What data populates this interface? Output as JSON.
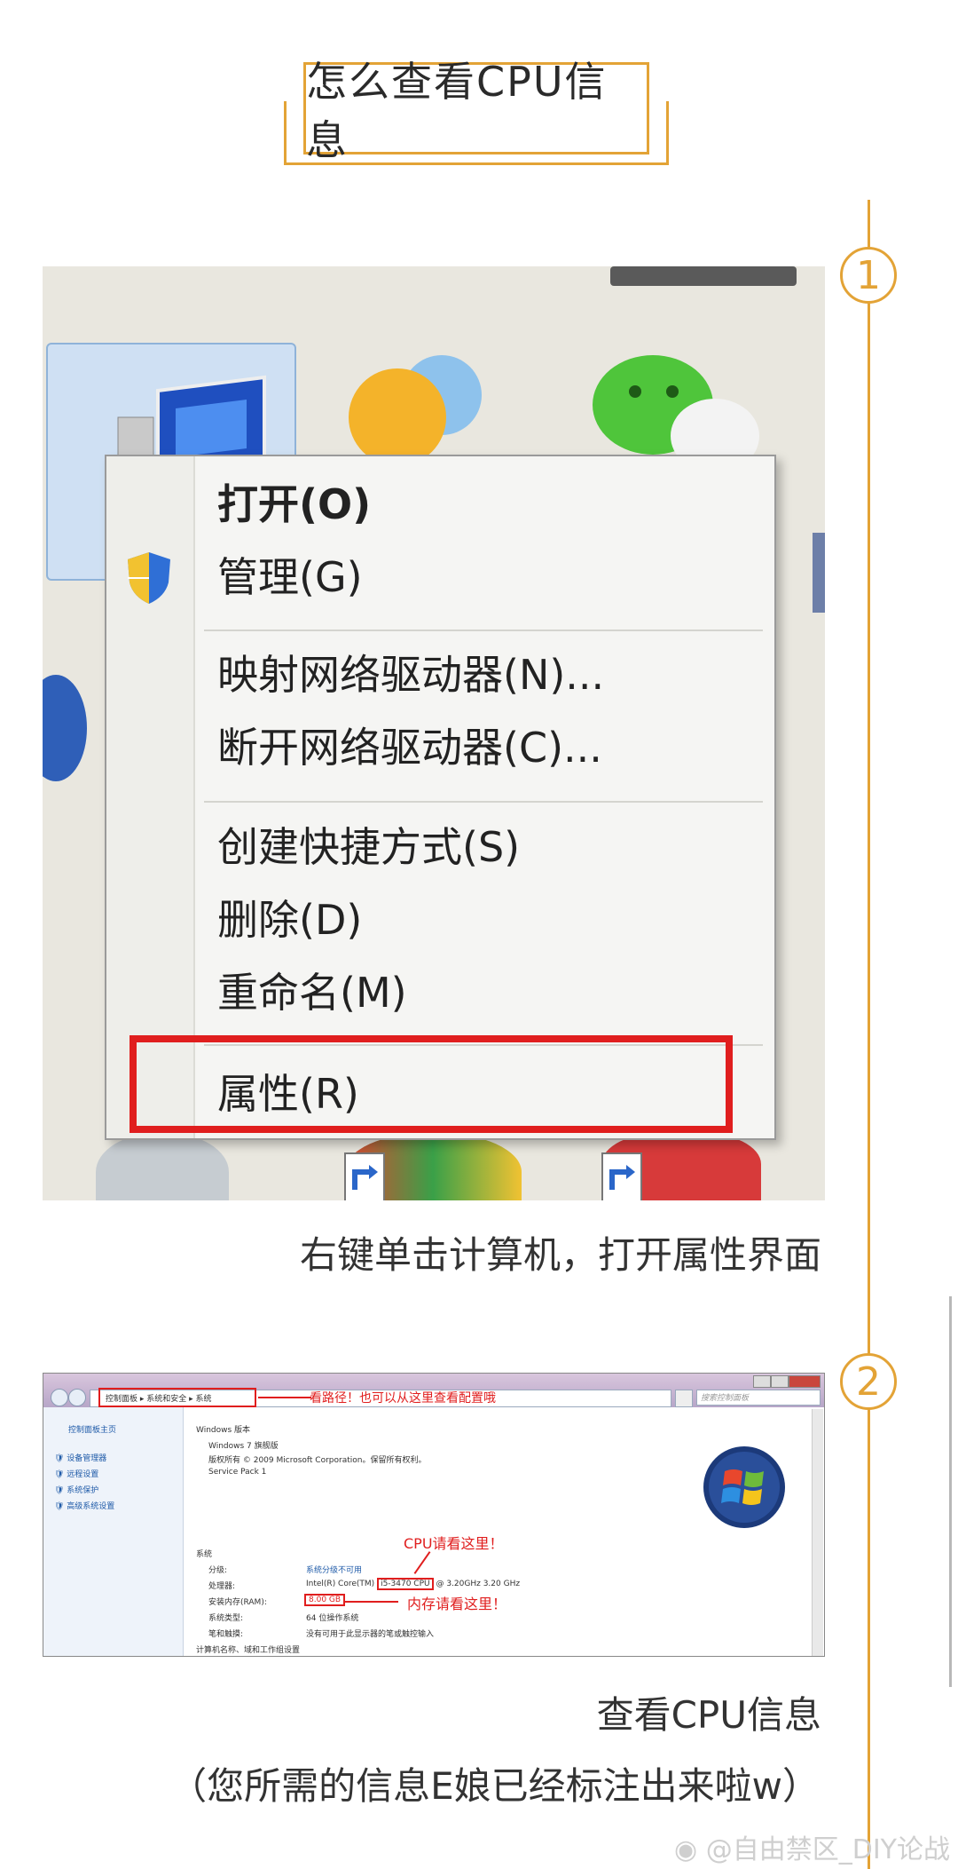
{
  "title": "怎么查看CPU信息",
  "steps": [
    {
      "number": "1",
      "caption": "右键单击计算机，打开属性界面"
    },
    {
      "number": "2",
      "caption": "查看CPU信息",
      "note": "（您所需的信息E娘已经标注出来啦w）"
    }
  ],
  "context_menu": {
    "items": [
      {
        "label": "打开(O)",
        "bold": true
      },
      {
        "label": "管理(G)"
      },
      {
        "label": "映射网络驱动器(N)..."
      },
      {
        "label": "断开网络驱动器(C)..."
      },
      {
        "label": "创建快捷方式(S)"
      },
      {
        "label": "删除(D)"
      },
      {
        "label": "重命名(M)"
      },
      {
        "label": "属性(R)",
        "highlighted": true
      }
    ]
  },
  "system_window": {
    "breadcrumb": [
      "控制面板",
      "系统和安全",
      "系统"
    ],
    "breadcrumb_note": "看路径！也可以从这里查看配置哦",
    "search_placeholder": "搜索控制面板",
    "sidebar": [
      "控制面板主页",
      "设备管理器",
      "远程设置",
      "系统保护",
      "高级系统设置"
    ],
    "windows_edition_heading": "Windows 版本",
    "edition": "Windows 7 旗舰版",
    "copyright": "版权所有 © 2009 Microsoft Corporation。保留所有权利。",
    "service_pack": "Service Pack 1",
    "system_heading": "系统",
    "rows": [
      {
        "label": "分级:",
        "value": "系统分级不可用"
      },
      {
        "label": "处理器:",
        "value_prefix": "Intel(R) Core(TM)",
        "value_highlight": "i5-3470 CPU",
        "value_suffix": "@ 3.20GHz   3.20 GHz"
      },
      {
        "label": "安装内存(RAM):",
        "value_highlight": "8.00 GB"
      },
      {
        "label": "系统类型:",
        "value": "64 位操作系统"
      },
      {
        "label": "笔和触摸:",
        "value": "没有可用于此显示器的笔或触控输入"
      }
    ],
    "computer_name_heading": "计算机名称、域和工作组设置",
    "cpu_note": "CPU请看这里！",
    "ram_note": "内存请看这里！"
  },
  "watermark": "@自由禁区_DIY论战",
  "colors": {
    "accent": "#e3a336",
    "highlight": "#e01e1e"
  }
}
